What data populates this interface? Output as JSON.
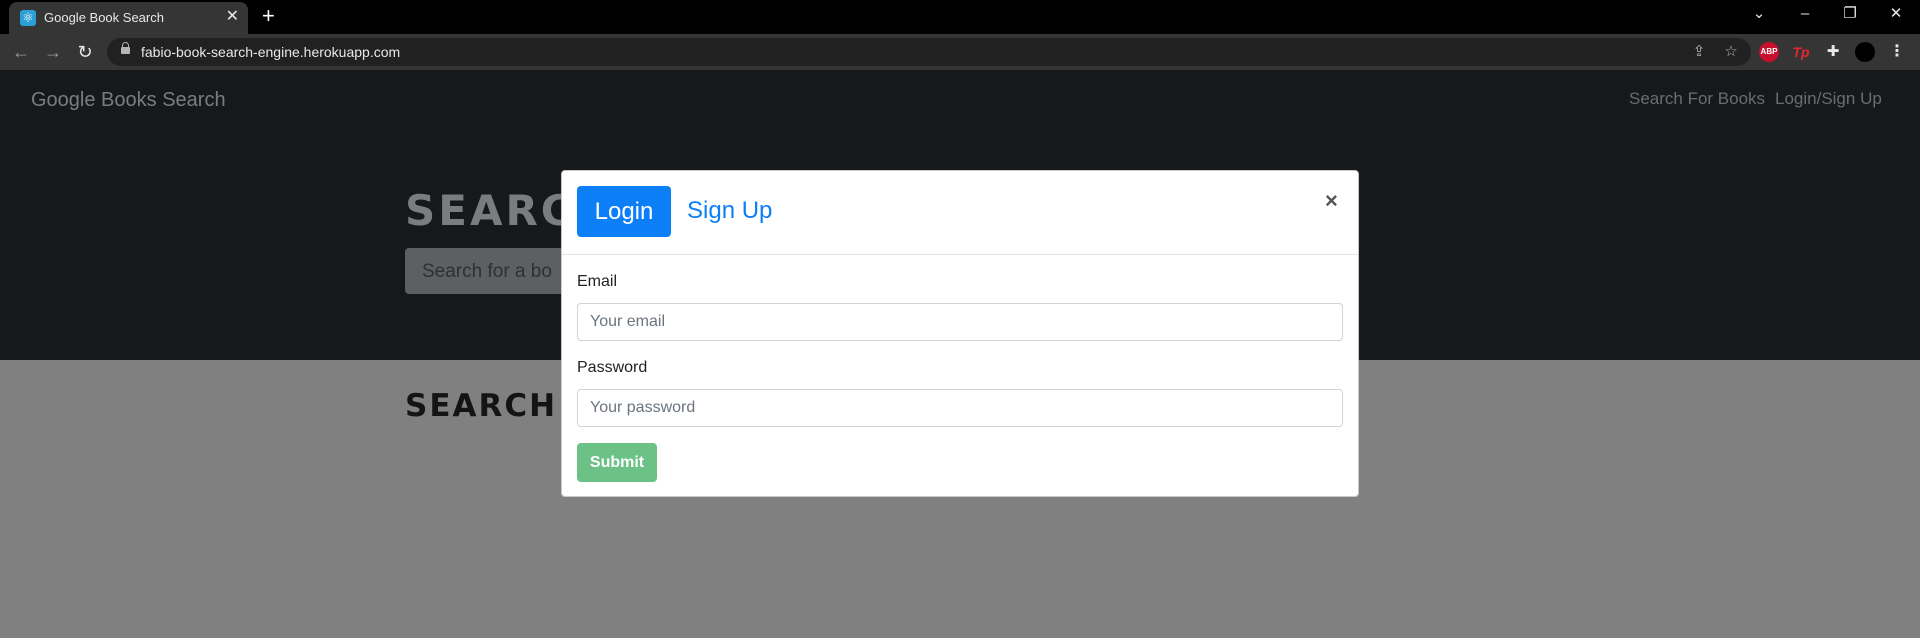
{
  "browser": {
    "tab_title": "Google Book Search",
    "url": "fabio-book-search-engine.herokuapp.com",
    "extensions": {
      "abp": "ABP",
      "tp": "Tp"
    }
  },
  "navbar": {
    "brand": "Google Books Search",
    "links": [
      "Search For Books",
      "Login/Sign Up"
    ]
  },
  "hero": {
    "heading": "SEARCH",
    "search_placeholder": "Search for a bo"
  },
  "results": {
    "heading": "SEARCH"
  },
  "modal": {
    "tabs": [
      "Login",
      "Sign Up"
    ],
    "close": "×",
    "email_label": "Email",
    "email_placeholder": "Your email",
    "password_label": "Password",
    "password_placeholder": "Your password",
    "submit": "Submit"
  },
  "colors": {
    "primary": "#0d7ff6",
    "submit_disabled": "#6cc286",
    "hero_bg": "#16191b",
    "overlay_bg": "#808080"
  }
}
